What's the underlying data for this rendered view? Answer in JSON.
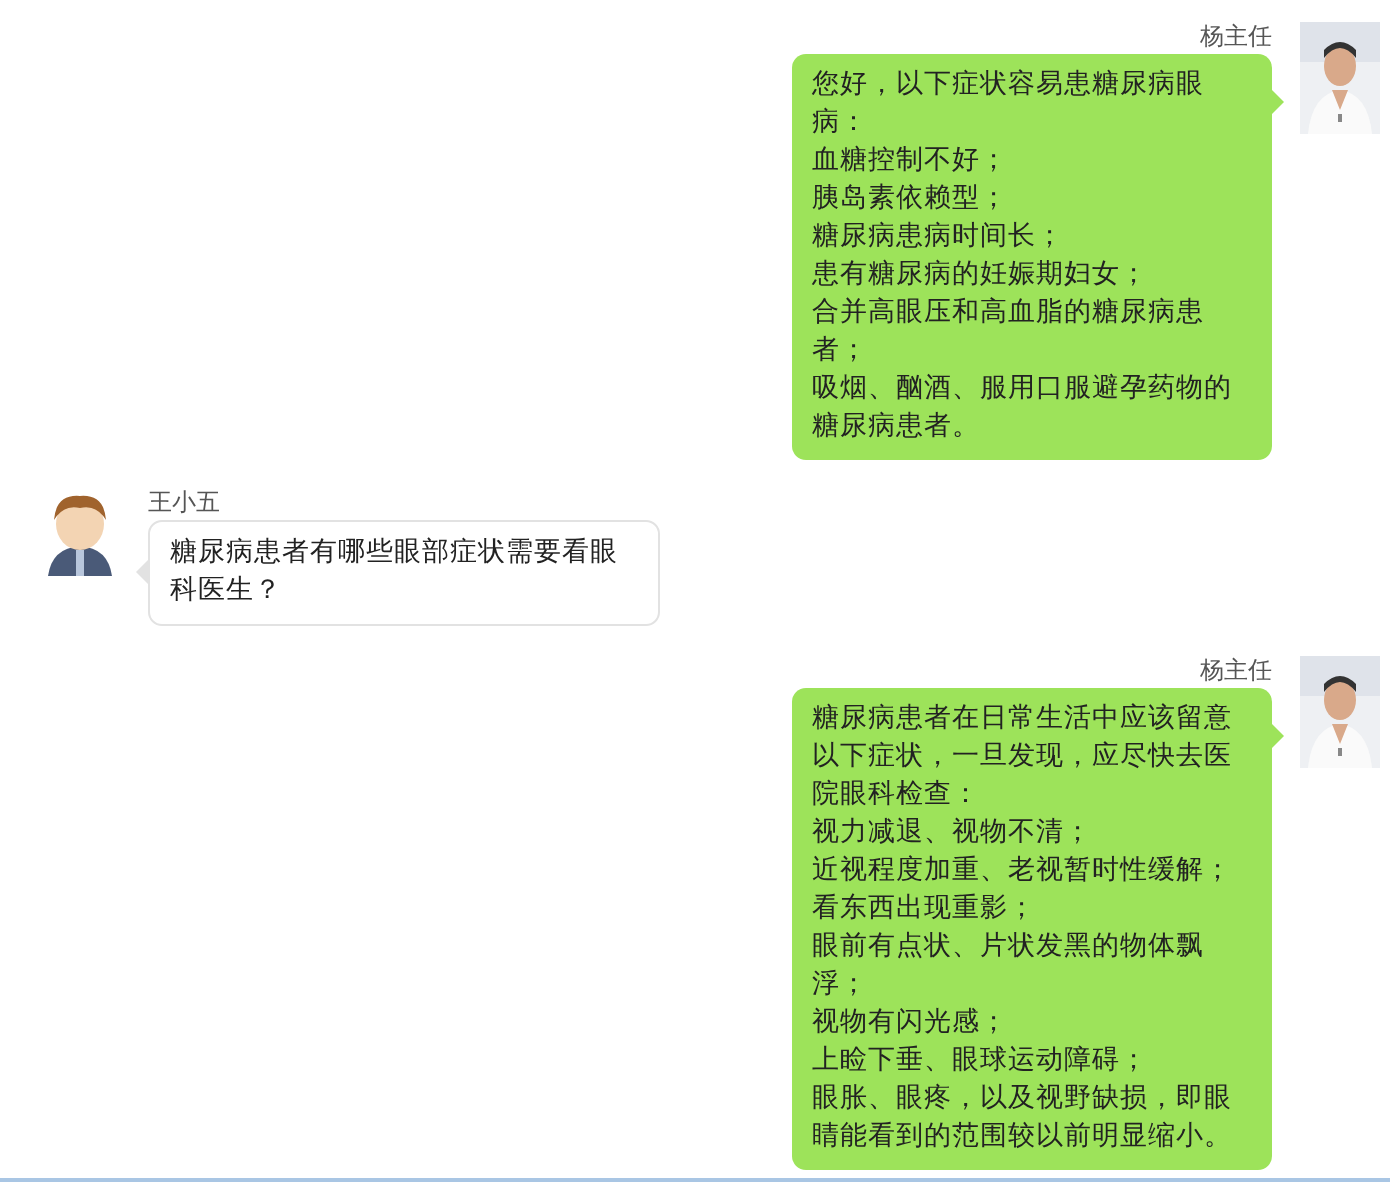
{
  "messages": [
    {
      "kind": "outgoing",
      "sender": "杨主任",
      "lines": [
        "您好，以下症状容易患糖尿病眼病：",
        "血糖控制不好；",
        "胰岛素依赖型；",
        "糖尿病患病时间长；",
        "患有糖尿病的妊娠期妇女；",
        "合并高眼压和高血脂的糖尿病患者；",
        "吸烟、酗酒、服用口服避孕药物的糖尿病患者。"
      ]
    },
    {
      "kind": "incoming",
      "sender": "王小五",
      "lines": [
        "糖尿病患者有哪些眼部症状需要看眼科医生？"
      ]
    },
    {
      "kind": "outgoing",
      "sender": "杨主任",
      "lines": [
        "糖尿病患者在日常生活中应该留意以下症状，一旦发现，应尽快去医院眼科检查：",
        "视力减退、视物不清；",
        "近视程度加重、老视暂时性缓解；",
        "看东西出现重影；",
        "眼前有点状、片状发黑的物体飘浮；",
        "视物有闪光感；",
        "上睑下垂、眼球运动障碍；",
        "眼胀、眼疼，以及视野缺损，即眼睛能看到的范围较以前明显缩小。"
      ]
    }
  ]
}
